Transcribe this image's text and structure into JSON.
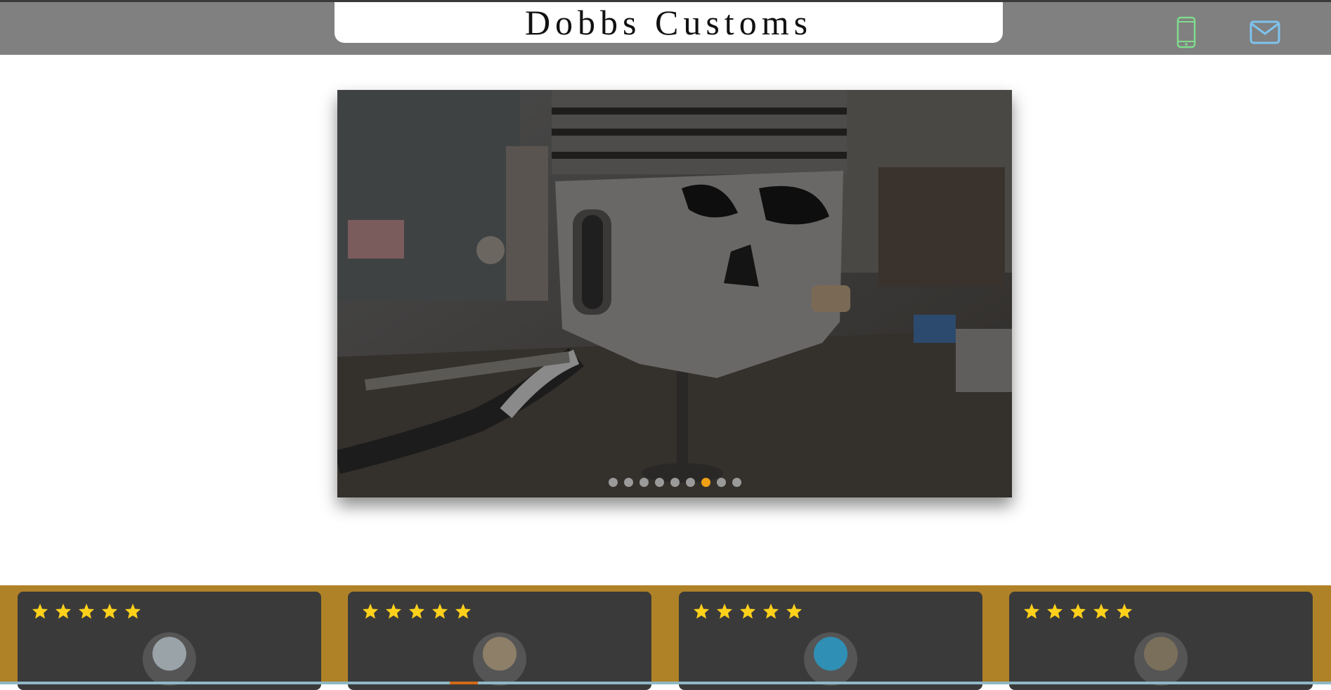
{
  "header": {
    "title": "Dobbs Customs",
    "phone_icon": "phone-icon",
    "mail_icon": "mail-icon",
    "colors": {
      "bar": "#808080",
      "phone": "#7fdc8c",
      "mail": "#7ec3ee"
    }
  },
  "slider": {
    "dot_count": 9,
    "active_dot": 6,
    "accent": "#f0a014"
  },
  "reviews": {
    "background": "#b08227",
    "cards": [
      {
        "stars": 5,
        "avatar_icon": "avatar"
      },
      {
        "stars": 5,
        "avatar_icon": "avatar"
      },
      {
        "stars": 5,
        "avatar_icon": "avatar"
      },
      {
        "stars": 5,
        "avatar_icon": "avatar"
      }
    ]
  }
}
